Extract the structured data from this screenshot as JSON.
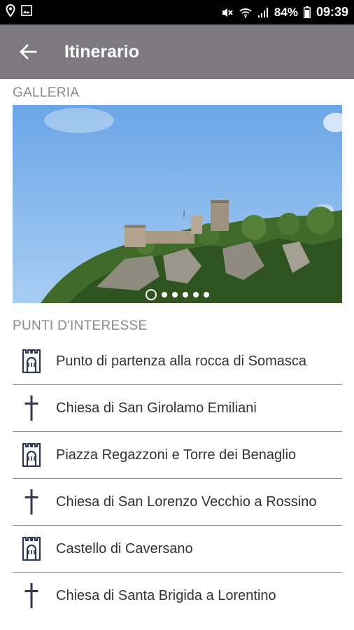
{
  "status_bar": {
    "battery_percent": "84%",
    "time": "09:39",
    "icons": [
      "location-icon",
      "image-notification-icon",
      "mute-icon",
      "wifi-icon",
      "signal-icon",
      "battery-icon"
    ]
  },
  "app_bar": {
    "title": "Itinerario",
    "back_icon": "arrow-left-icon",
    "background": "#7d7a7f"
  },
  "gallery": {
    "label": "GALLERIA",
    "image": "castle-on-rocky-cliff-photo",
    "slide_count": 6,
    "active_slide": 1
  },
  "points_of_interest": {
    "label": "PUNTI D'INTERESSE",
    "icon_color": "#2f3852",
    "items": [
      {
        "label": "Punto di partenza alla rocca di Somasca",
        "icon": "tower-icon"
      },
      {
        "label": "Chiesa di San Girolamo Emiliani",
        "icon": "cross-icon"
      },
      {
        "label": "Piazza Regazzoni e Torre dei Benaglio",
        "icon": "tower-icon"
      },
      {
        "label": "Chiesa di San Lorenzo Vecchio a Rossino",
        "icon": "cross-icon"
      },
      {
        "label": "Castello di Caversano",
        "icon": "tower-icon"
      },
      {
        "label": "Chiesa di Santa Brigida a Lorentino",
        "icon": "cross-icon"
      }
    ]
  }
}
